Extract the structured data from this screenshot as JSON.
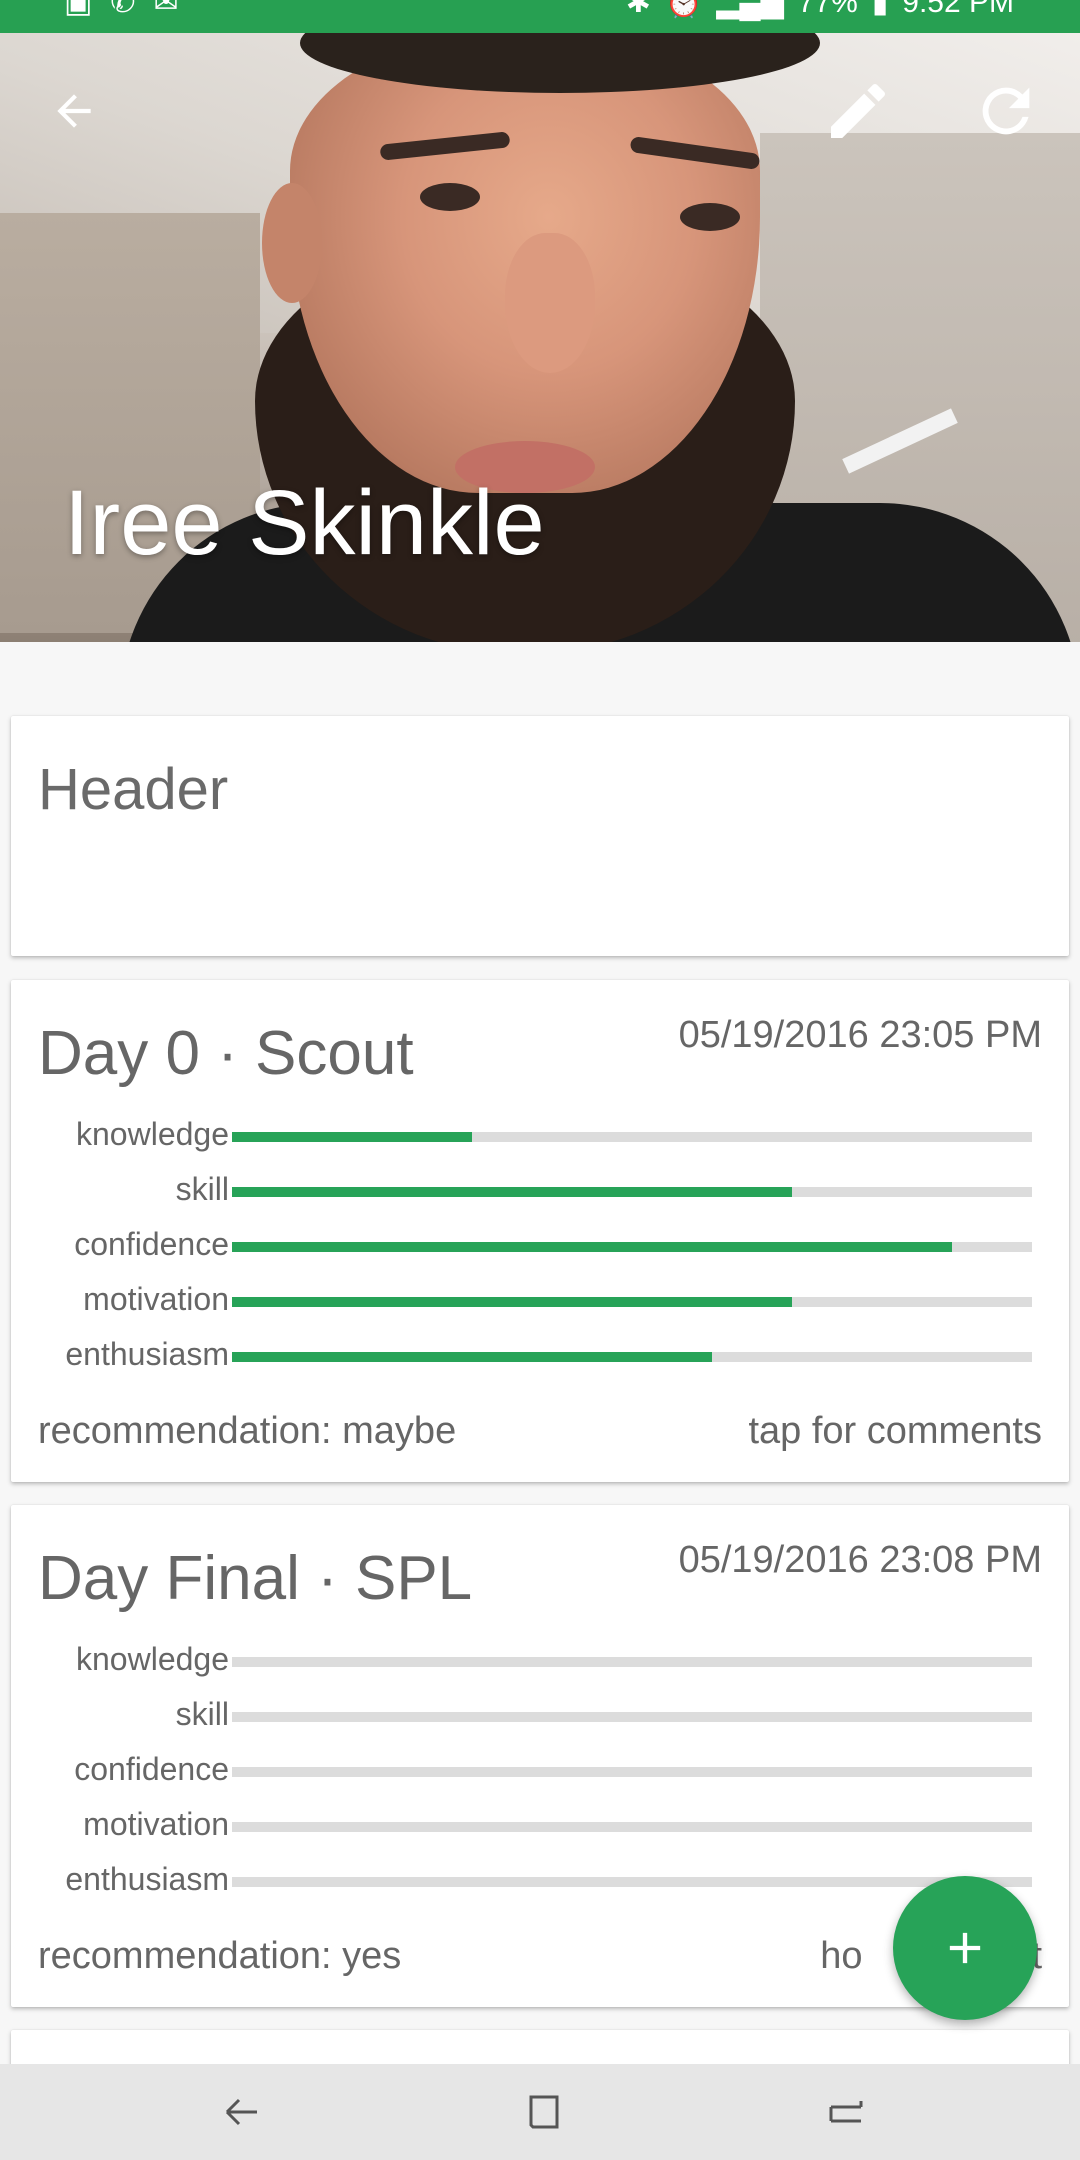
{
  "status_bar": {
    "battery": "77%",
    "time": "9:52 PM"
  },
  "hero": {
    "title": "Iree Skinkle",
    "icons": [
      "back-arrow-icon",
      "edit-pencil-icon",
      "refresh-icon"
    ]
  },
  "header_card": {
    "text": "Header"
  },
  "days": [
    {
      "title": "Day 0 · Scout",
      "date": "05/19/2016 23:05 PM",
      "metrics": [
        {
          "label": "knowledge",
          "value": 0.3
        },
        {
          "label": "skill",
          "value": 0.7
        },
        {
          "label": "confidence",
          "value": 0.9
        },
        {
          "label": "motivation",
          "value": 0.7
        },
        {
          "label": "enthusiasm",
          "value": 0.6
        }
      ],
      "recommendation": "recommendation: maybe",
      "action": "tap for comments"
    },
    {
      "title": "Day Final · SPL",
      "date": "05/19/2016 23:08 PM",
      "metrics": [
        {
          "label": "knowledge",
          "value": 0
        },
        {
          "label": "skill",
          "value": 0
        },
        {
          "label": "confidence",
          "value": 0
        },
        {
          "label": "motivation",
          "value": 0
        },
        {
          "label": "enthusiasm",
          "value": 0
        }
      ],
      "recommendation": "recommendation: yes",
      "action": "ho                t"
    }
  ],
  "fab": {
    "icon": "plus-icon"
  },
  "colors": {
    "accent": "#27a358",
    "status_bar": "#27a052",
    "track": "#dcdcdc"
  }
}
